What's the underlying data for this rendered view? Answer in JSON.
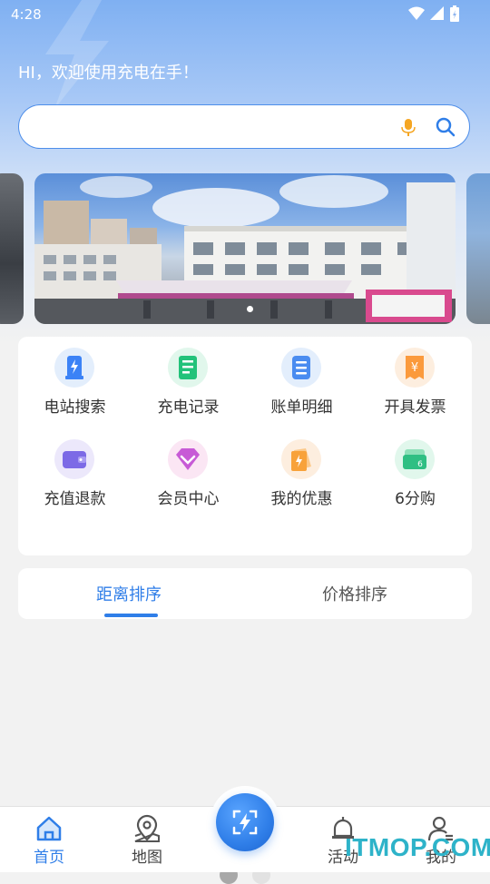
{
  "status_bar": {
    "time": "4:28"
  },
  "header": {
    "welcome": "HI，欢迎使用充电在手！"
  },
  "search": {
    "value": "",
    "placeholder": ""
  },
  "banner": {
    "image": "charging-station-photo",
    "active_index": 1
  },
  "quick_actions": {
    "items": [
      {
        "label": "电站搜索",
        "icon": "charging-pile-icon",
        "bg": "#e3eefc",
        "fg": "#3b82f6"
      },
      {
        "label": "充电记录",
        "icon": "record-icon",
        "bg": "#e1f7ec",
        "fg": "#22c27a"
      },
      {
        "label": "账单明细",
        "icon": "bill-icon",
        "bg": "#e3eefc",
        "fg": "#4a8cf0"
      },
      {
        "label": "开具发票",
        "icon": "invoice-icon",
        "bg": "#fdeedf",
        "fg": "#fb9a3c"
      },
      {
        "label": "充值退款",
        "icon": "wallet-icon",
        "bg": "#ece8fb",
        "fg": "#7c6ae6"
      },
      {
        "label": "会员中心",
        "icon": "diamond-icon",
        "bg": "#fbe6f4",
        "fg": "#c75ad6"
      },
      {
        "label": "我的优惠",
        "icon": "coupon-icon",
        "bg": "#fdeedf",
        "fg": "#f8a23a"
      },
      {
        "label": "6分购",
        "icon": "cash-icon",
        "bg": "#e1f7ec",
        "fg": "#2fbf83"
      }
    ],
    "pages": 2,
    "active_page": 1
  },
  "sort_tabs": [
    {
      "label": "距离排序",
      "active": true
    },
    {
      "label": "价格排序",
      "active": false
    }
  ],
  "bottom_nav": [
    {
      "label": "首页",
      "icon": "home-icon",
      "active": true
    },
    {
      "label": "地图",
      "icon": "map-pin-icon",
      "active": false
    },
    {
      "label": "活动",
      "icon": "bell-icon",
      "active": false
    },
    {
      "label": "我的",
      "icon": "user-icon",
      "active": false
    }
  ],
  "watermark": "ITMOP.COM",
  "colors": {
    "accent": "#2f7ee8",
    "search_border": "#4d8eea",
    "background": "#f2f2f2"
  }
}
